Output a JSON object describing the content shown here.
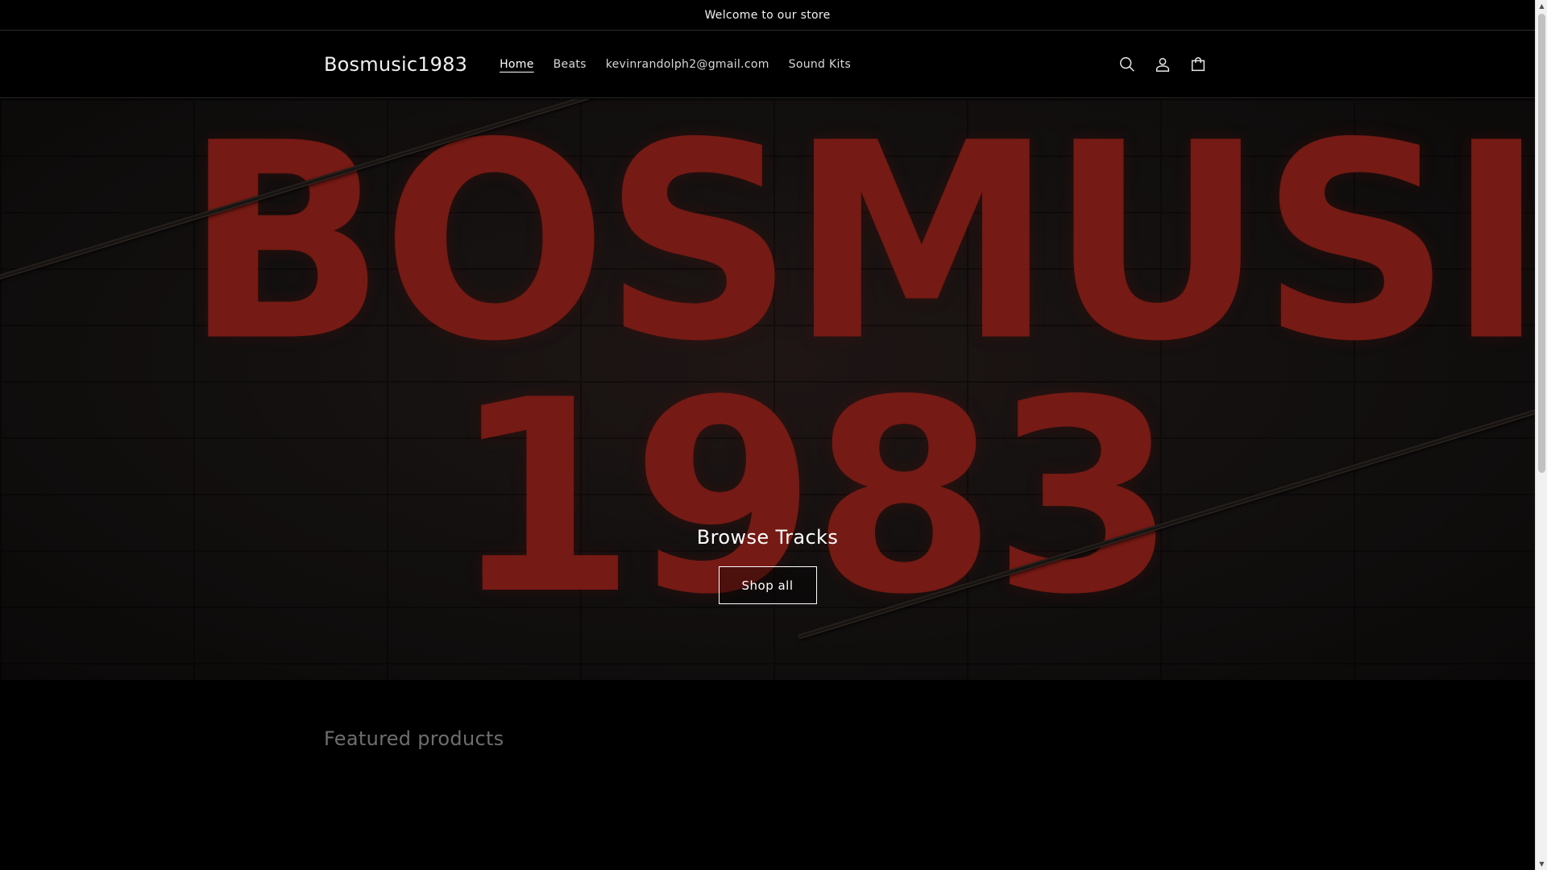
{
  "announcement": {
    "text": "Welcome to our store"
  },
  "header": {
    "logo": "Bosmusic1983",
    "nav": [
      {
        "label": "Home",
        "active": true
      },
      {
        "label": "Beats"
      },
      {
        "label": "kevinrandolph2@gmail.com"
      },
      {
        "label": "Sound Kits"
      }
    ],
    "icons": [
      "search-icon",
      "account-icon",
      "cart-icon"
    ]
  },
  "hero": {
    "image_text_line1": "BOSMUSIC",
    "image_text_line2": "1983",
    "title": "Browse Tracks",
    "button_label": "Shop all"
  },
  "featured": {
    "title": "Featured products"
  },
  "colors": {
    "background": "#000000",
    "accent_red": "#a3241c",
    "text": "#ffffff",
    "muted": "#6e6e6e"
  }
}
